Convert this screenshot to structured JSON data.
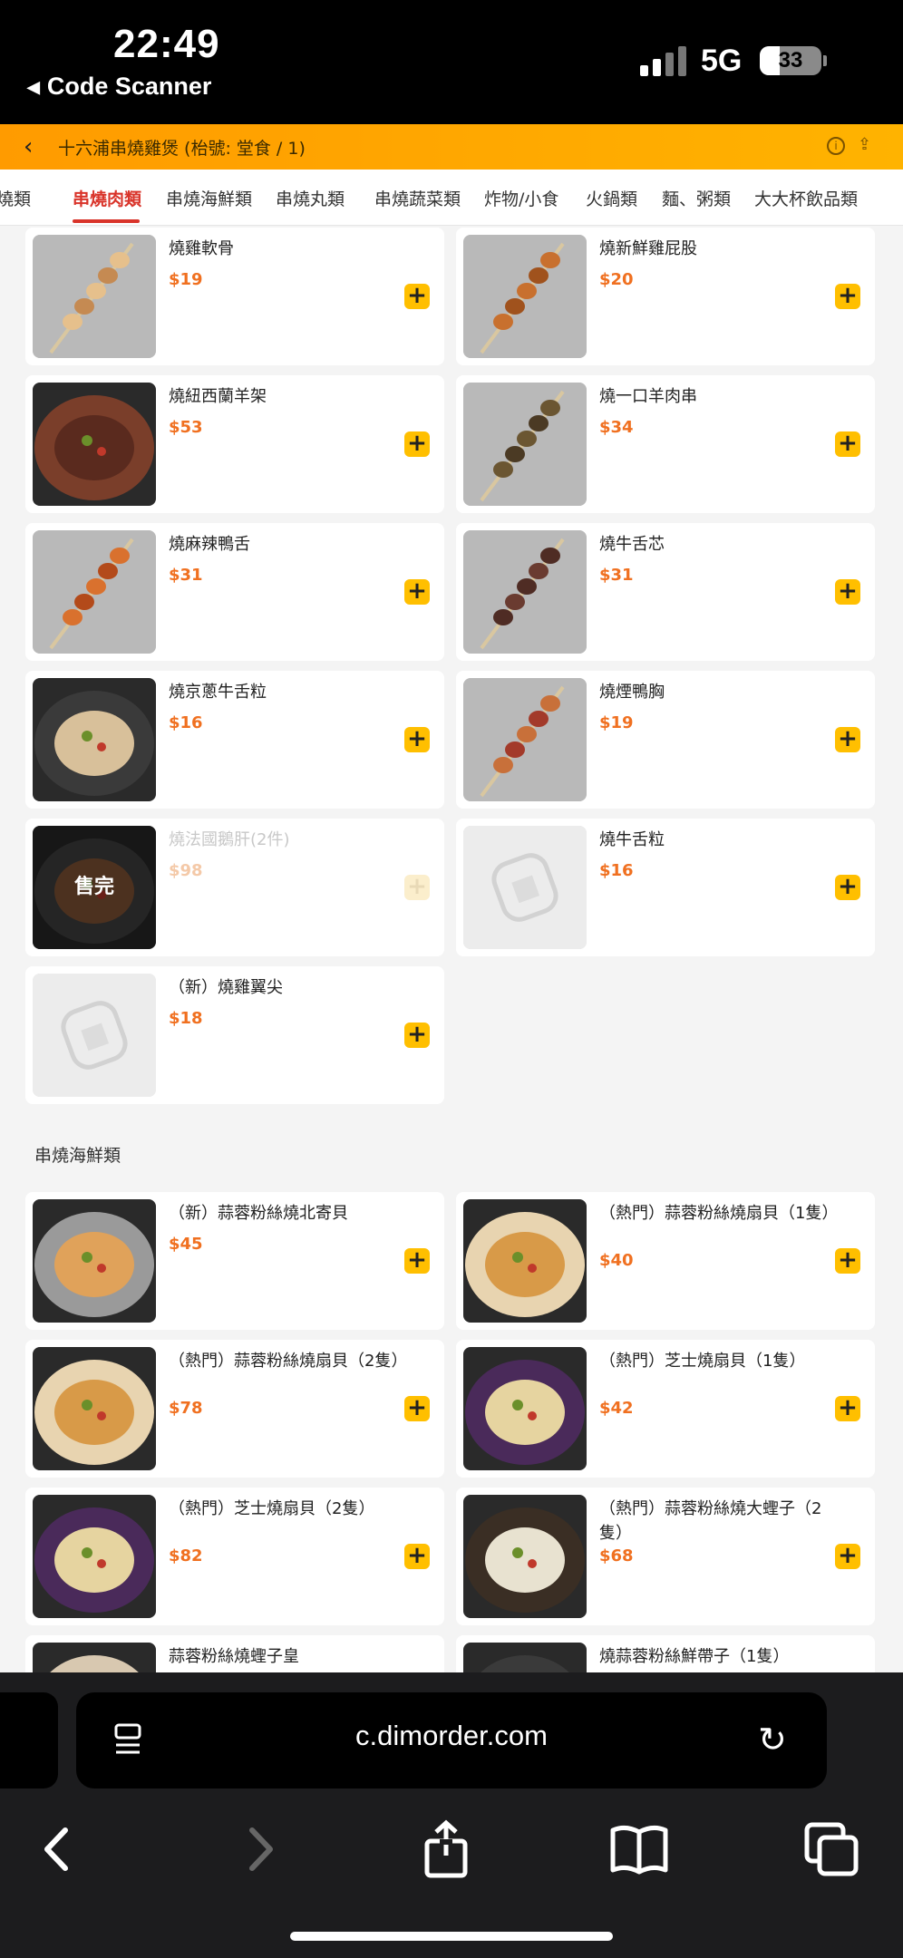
{
  "status_bar": {
    "time": "22:49",
    "back_app": "Code Scanner",
    "network": "5G",
    "battery": "33"
  },
  "header": {
    "title": "十六浦串燒雞煲 (枱號: 堂食 / 1)"
  },
  "tabs": [
    {
      "label": "燒類",
      "active": false
    },
    {
      "label": "串燒肉類",
      "active": true
    },
    {
      "label": "串燒海鮮類",
      "active": false
    },
    {
      "label": "串燒丸類",
      "active": false
    },
    {
      "label": "串燒蔬菜類",
      "active": false
    },
    {
      "label": "炸物/小食",
      "active": false
    },
    {
      "label": "火鍋類",
      "active": false
    },
    {
      "label": "麵、粥類",
      "active": false
    },
    {
      "label": "大大杯飲品類",
      "active": false
    }
  ],
  "meat_items": [
    {
      "name": "燒雞軟骨",
      "price": "$19"
    },
    {
      "name": "燒新鮮雞屁股",
      "price": "$20"
    },
    {
      "name": "燒紐西蘭羊架",
      "price": "$53"
    },
    {
      "name": "燒一口羊肉串",
      "price": "$34"
    },
    {
      "name": "燒麻辣鴨舌",
      "price": "$31"
    },
    {
      "name": "燒牛舌芯",
      "price": "$31"
    },
    {
      "name": "燒京蔥牛舌粒",
      "price": "$16"
    },
    {
      "name": "燒煙鴨胸",
      "price": "$19"
    },
    {
      "name": "燒法國鵝肝(2件)",
      "price": "$98",
      "sold_out": "售完"
    },
    {
      "name": "燒牛舌粒",
      "price": "$16"
    },
    {
      "name": "（新）燒雞翼尖",
      "price": "$18"
    }
  ],
  "seafood_section": {
    "title": "串燒海鮮類"
  },
  "seafood_items": [
    {
      "name": "（新）蒜蓉粉絲燒北寄貝",
      "price": "$45"
    },
    {
      "name": "（熱門）蒜蓉粉絲燒扇貝（1隻）",
      "price": "$40"
    },
    {
      "name": "（熱門）蒜蓉粉絲燒扇貝（2隻）",
      "price": "$78"
    },
    {
      "name": "（熱門）芝士燒扇貝（1隻）",
      "price": "$42"
    },
    {
      "name": "（熱門）芝士燒扇貝（2隻）",
      "price": "$82"
    },
    {
      "name": "（熱門）蒜蓉粉絲燒大蟶子（2隻）",
      "price": "$68"
    },
    {
      "name": "蒜蓉粉絲燒蟶子皇",
      "price": ""
    },
    {
      "name": "燒蒜蓉粉絲鮮帶子（1隻）",
      "price": ""
    }
  ],
  "browser": {
    "url": "c.dimorder.com"
  },
  "add_symbol": "+",
  "colors": {
    "accent": "#ffb300",
    "active_tab": "#d9342a",
    "price": "#f07020"
  }
}
